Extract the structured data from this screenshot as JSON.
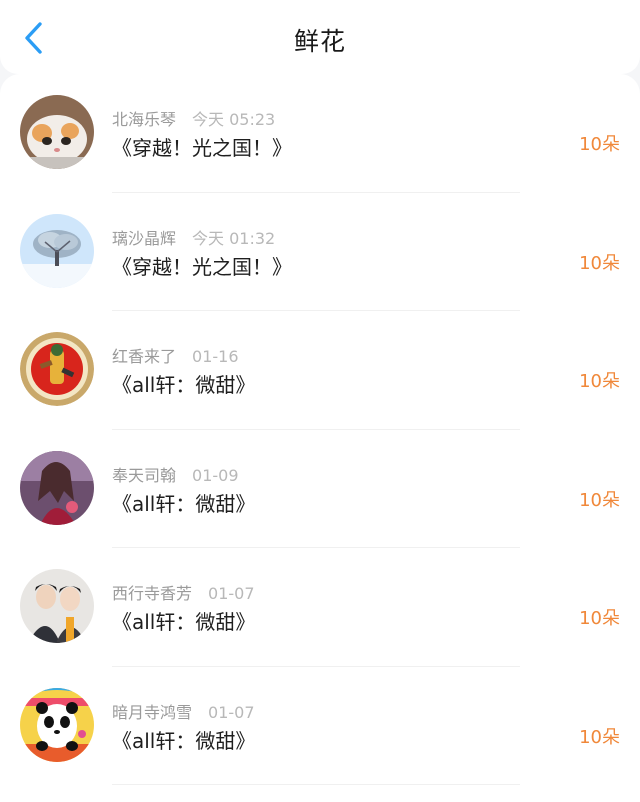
{
  "header": {
    "title": "鲜花"
  },
  "colors": {
    "accent_blue": "#2b9df5",
    "amount_orange": "#f0883a"
  },
  "icons": {
    "back": "chevron-left-icon"
  },
  "records": [
    {
      "user": "北海乐琴",
      "time": "今天 05:23",
      "book": "《穿越！光之国！》",
      "amount": "10朵",
      "avatar": "kitten"
    },
    {
      "user": "璃沙晶辉",
      "time": "今天 01:32",
      "book": "《穿越！光之国！》",
      "amount": "10朵",
      "avatar": "snowy-tree"
    },
    {
      "user": "红香来了",
      "time": "01-16",
      "book": "《all轩：微甜》",
      "amount": "10朵",
      "avatar": "warrior-medallion"
    },
    {
      "user": "奉天司翰",
      "time": "01-09",
      "book": "《all轩：微甜》",
      "amount": "10朵",
      "avatar": "fantasy-girl"
    },
    {
      "user": "西行寺香芳",
      "time": "01-07",
      "book": "《all轩：微甜》",
      "amount": "10朵",
      "avatar": "two-boys"
    },
    {
      "user": "暗月寺鸿雪",
      "time": "01-07",
      "book": "《all轩：微甜》",
      "amount": "10朵",
      "avatar": "panda"
    }
  ]
}
